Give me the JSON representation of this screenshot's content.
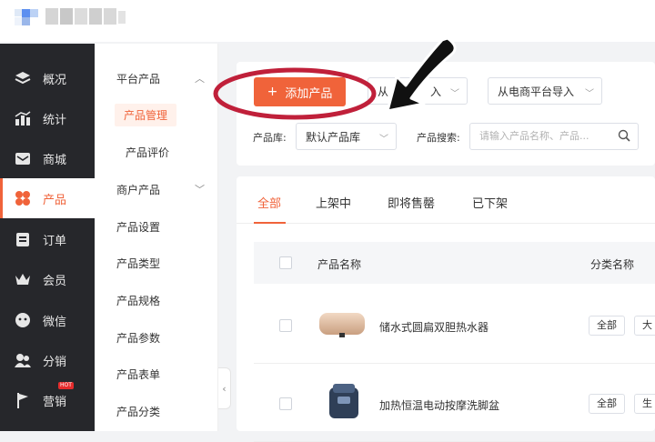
{
  "header": {
    "logo": "logo"
  },
  "sidebar": {
    "items": [
      {
        "label": "概况",
        "icon": "layers-icon"
      },
      {
        "label": "统计",
        "icon": "chart-icon"
      },
      {
        "label": "商城",
        "icon": "mail-icon"
      },
      {
        "label": "产品",
        "icon": "flower-icon",
        "active": true
      },
      {
        "label": "订单",
        "icon": "clipboard-icon"
      },
      {
        "label": "会员",
        "icon": "crown-icon"
      },
      {
        "label": "微信",
        "icon": "chat-icon"
      },
      {
        "label": "分销",
        "icon": "users-icon"
      },
      {
        "label": "营销",
        "icon": "flag-icon",
        "badge": "HOT"
      }
    ]
  },
  "submenu": {
    "group_platform": "平台产品",
    "manage": "产品管理",
    "review": "产品评价",
    "group_merchant": "商户产品",
    "settings": "产品设置",
    "types": "产品类型",
    "specs": "产品规格",
    "params": "产品参数",
    "forms": "产品表单",
    "category": "产品分类"
  },
  "toolbar": {
    "add_label": "添加产品",
    "import_from": "从",
    "import_tail": "入",
    "import_ecommerce": "从电商平台导入",
    "library_label": "产品库:",
    "library_value": "默认产品库",
    "search_label": "产品搜索:",
    "search_placeholder": "请输入产品名称、产品..."
  },
  "tabs": [
    "全部",
    "上架中",
    "即将售罄",
    "已下架"
  ],
  "table": {
    "col_name": "产品名称",
    "col_category": "分类名称",
    "rows": [
      {
        "name": "储水式圆扁双胆热水器",
        "tag": "全部",
        "tag2": "大"
      },
      {
        "name": "加热恒温电动按摩洗脚盆",
        "tag": "全部",
        "tag2": "生"
      }
    ]
  },
  "colors": {
    "accent": "#f0633a",
    "sidebar": "#26272b",
    "annotation": "#c0203a"
  }
}
